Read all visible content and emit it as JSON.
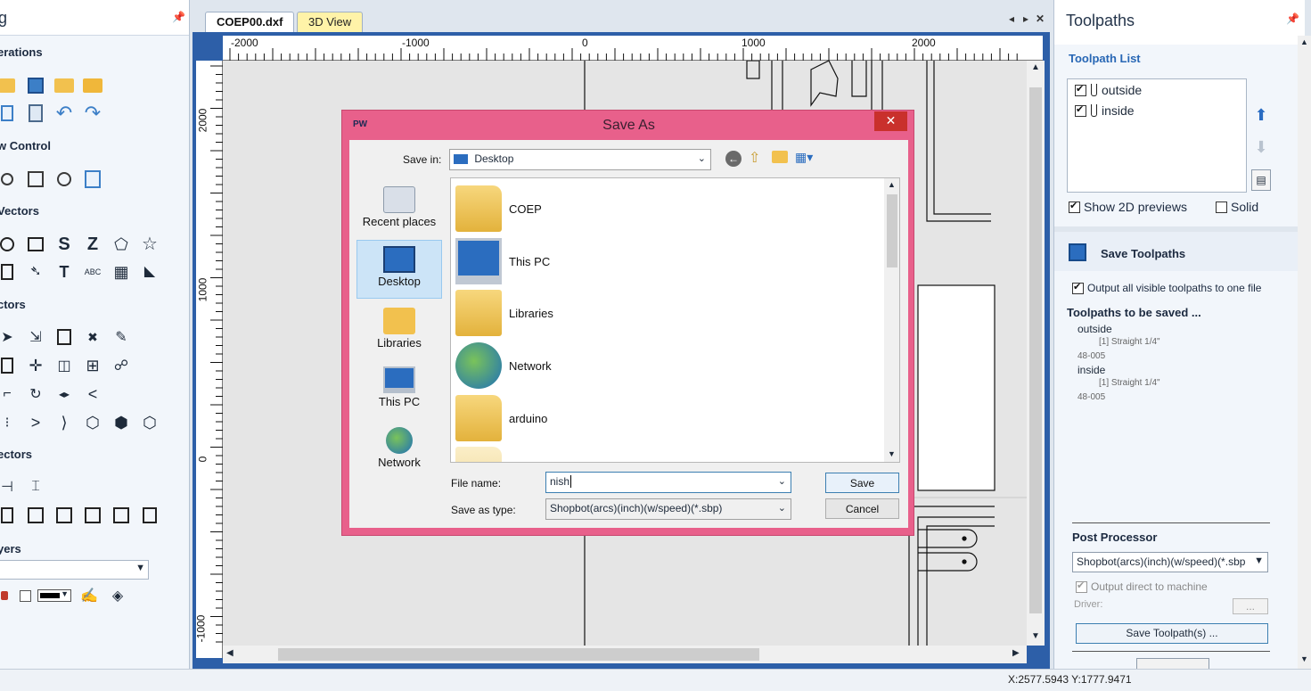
{
  "left_panel": {
    "title_fragment": "g",
    "sections": {
      "operations": "erations",
      "view_control": "w Control",
      "create_vectors": "Vectors",
      "edit_vectors": "ctors",
      "offset_vectors": "ectors",
      "layers": "yers"
    }
  },
  "doc_tabs": {
    "active": "COEP00.dxf",
    "other": "3D View"
  },
  "rulers": {
    "top": [
      "-2000",
      "-1000",
      "0",
      "1000",
      "2000"
    ],
    "left": [
      "2000",
      "1000",
      "0",
      "-1000"
    ]
  },
  "toolpaths_panel": {
    "title": "Toolpaths",
    "list_heading": "Toolpath List",
    "items": [
      {
        "name": "outside",
        "checked": true
      },
      {
        "name": "inside",
        "checked": true
      }
    ],
    "show_previews": "Show 2D previews",
    "solid": "Solid",
    "save_heading": "Save Toolpaths",
    "output_one_file": "Output all visible toolpaths to one file",
    "to_be_saved_heading": "Toolpaths to be saved ...",
    "to_be_saved": [
      {
        "name": "outside",
        "tool": "[1] Straight 1/4\"",
        "code": "48-005"
      },
      {
        "name": "inside",
        "tool": "[1] Straight 1/4\"",
        "code": "48-005"
      }
    ],
    "post_processor_heading": "Post Processor",
    "post_processor_value": "Shopbot(arcs)(inch)(w/speed)(*.sbp",
    "output_direct": "Output direct to machine",
    "driver_label": "Driver:",
    "driver_btn": "...",
    "save_btn": "Save Toolpath(s) ..."
  },
  "status_bar": {
    "coords": "X:2577.5943 Y:1777.9471"
  },
  "dialog": {
    "icon_text": "PW",
    "title": "Save As",
    "close": "✕",
    "save_in_label": "Save in:",
    "save_in_value": "Desktop",
    "places": [
      "Recent places",
      "Desktop",
      "Libraries",
      "This PC",
      "Network"
    ],
    "files": [
      "COEP",
      "This PC",
      "Libraries",
      "Network",
      "arduino"
    ],
    "file_name_label": "File name:",
    "file_name_value": "nish",
    "save_type_label": "Save as type:",
    "save_type_value": "Shopbot(arcs)(inch)(w/speed)(*.sbp)",
    "save_btn": "Save",
    "cancel_btn": "Cancel"
  },
  "colors": {
    "dialog_frame": "#e8608b",
    "close_button": "#c9302c",
    "accent_heading": "#2867b5",
    "view_frame": "#2d5fa8"
  }
}
